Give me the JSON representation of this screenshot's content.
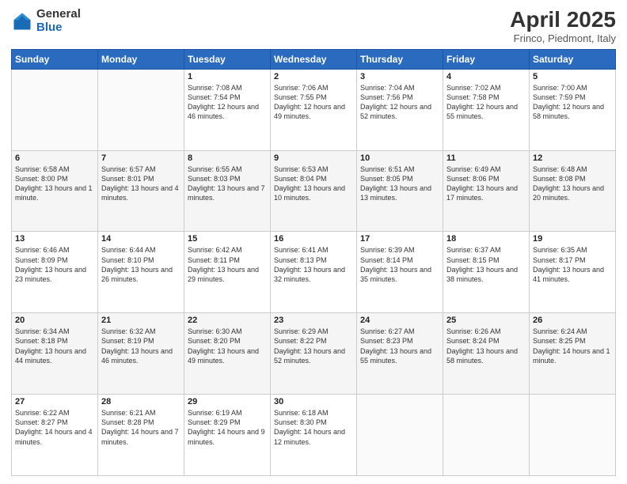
{
  "logo": {
    "general": "General",
    "blue": "Blue"
  },
  "header": {
    "title": "April 2025",
    "location": "Frinco, Piedmont, Italy"
  },
  "weekdays": [
    "Sunday",
    "Monday",
    "Tuesday",
    "Wednesday",
    "Thursday",
    "Friday",
    "Saturday"
  ],
  "weeks": [
    [
      {
        "day": "",
        "info": ""
      },
      {
        "day": "",
        "info": ""
      },
      {
        "day": "1",
        "info": "Sunrise: 7:08 AM\nSunset: 7:54 PM\nDaylight: 12 hours and 46 minutes."
      },
      {
        "day": "2",
        "info": "Sunrise: 7:06 AM\nSunset: 7:55 PM\nDaylight: 12 hours and 49 minutes."
      },
      {
        "day": "3",
        "info": "Sunrise: 7:04 AM\nSunset: 7:56 PM\nDaylight: 12 hours and 52 minutes."
      },
      {
        "day": "4",
        "info": "Sunrise: 7:02 AM\nSunset: 7:58 PM\nDaylight: 12 hours and 55 minutes."
      },
      {
        "day": "5",
        "info": "Sunrise: 7:00 AM\nSunset: 7:59 PM\nDaylight: 12 hours and 58 minutes."
      }
    ],
    [
      {
        "day": "6",
        "info": "Sunrise: 6:58 AM\nSunset: 8:00 PM\nDaylight: 13 hours and 1 minute."
      },
      {
        "day": "7",
        "info": "Sunrise: 6:57 AM\nSunset: 8:01 PM\nDaylight: 13 hours and 4 minutes."
      },
      {
        "day": "8",
        "info": "Sunrise: 6:55 AM\nSunset: 8:03 PM\nDaylight: 13 hours and 7 minutes."
      },
      {
        "day": "9",
        "info": "Sunrise: 6:53 AM\nSunset: 8:04 PM\nDaylight: 13 hours and 10 minutes."
      },
      {
        "day": "10",
        "info": "Sunrise: 6:51 AM\nSunset: 8:05 PM\nDaylight: 13 hours and 13 minutes."
      },
      {
        "day": "11",
        "info": "Sunrise: 6:49 AM\nSunset: 8:06 PM\nDaylight: 13 hours and 17 minutes."
      },
      {
        "day": "12",
        "info": "Sunrise: 6:48 AM\nSunset: 8:08 PM\nDaylight: 13 hours and 20 minutes."
      }
    ],
    [
      {
        "day": "13",
        "info": "Sunrise: 6:46 AM\nSunset: 8:09 PM\nDaylight: 13 hours and 23 minutes."
      },
      {
        "day": "14",
        "info": "Sunrise: 6:44 AM\nSunset: 8:10 PM\nDaylight: 13 hours and 26 minutes."
      },
      {
        "day": "15",
        "info": "Sunrise: 6:42 AM\nSunset: 8:11 PM\nDaylight: 13 hours and 29 minutes."
      },
      {
        "day": "16",
        "info": "Sunrise: 6:41 AM\nSunset: 8:13 PM\nDaylight: 13 hours and 32 minutes."
      },
      {
        "day": "17",
        "info": "Sunrise: 6:39 AM\nSunset: 8:14 PM\nDaylight: 13 hours and 35 minutes."
      },
      {
        "day": "18",
        "info": "Sunrise: 6:37 AM\nSunset: 8:15 PM\nDaylight: 13 hours and 38 minutes."
      },
      {
        "day": "19",
        "info": "Sunrise: 6:35 AM\nSunset: 8:17 PM\nDaylight: 13 hours and 41 minutes."
      }
    ],
    [
      {
        "day": "20",
        "info": "Sunrise: 6:34 AM\nSunset: 8:18 PM\nDaylight: 13 hours and 44 minutes."
      },
      {
        "day": "21",
        "info": "Sunrise: 6:32 AM\nSunset: 8:19 PM\nDaylight: 13 hours and 46 minutes."
      },
      {
        "day": "22",
        "info": "Sunrise: 6:30 AM\nSunset: 8:20 PM\nDaylight: 13 hours and 49 minutes."
      },
      {
        "day": "23",
        "info": "Sunrise: 6:29 AM\nSunset: 8:22 PM\nDaylight: 13 hours and 52 minutes."
      },
      {
        "day": "24",
        "info": "Sunrise: 6:27 AM\nSunset: 8:23 PM\nDaylight: 13 hours and 55 minutes."
      },
      {
        "day": "25",
        "info": "Sunrise: 6:26 AM\nSunset: 8:24 PM\nDaylight: 13 hours and 58 minutes."
      },
      {
        "day": "26",
        "info": "Sunrise: 6:24 AM\nSunset: 8:25 PM\nDaylight: 14 hours and 1 minute."
      }
    ],
    [
      {
        "day": "27",
        "info": "Sunrise: 6:22 AM\nSunset: 8:27 PM\nDaylight: 14 hours and 4 minutes."
      },
      {
        "day": "28",
        "info": "Sunrise: 6:21 AM\nSunset: 8:28 PM\nDaylight: 14 hours and 7 minutes."
      },
      {
        "day": "29",
        "info": "Sunrise: 6:19 AM\nSunset: 8:29 PM\nDaylight: 14 hours and 9 minutes."
      },
      {
        "day": "30",
        "info": "Sunrise: 6:18 AM\nSunset: 8:30 PM\nDaylight: 14 hours and 12 minutes."
      },
      {
        "day": "",
        "info": ""
      },
      {
        "day": "",
        "info": ""
      },
      {
        "day": "",
        "info": ""
      }
    ]
  ]
}
